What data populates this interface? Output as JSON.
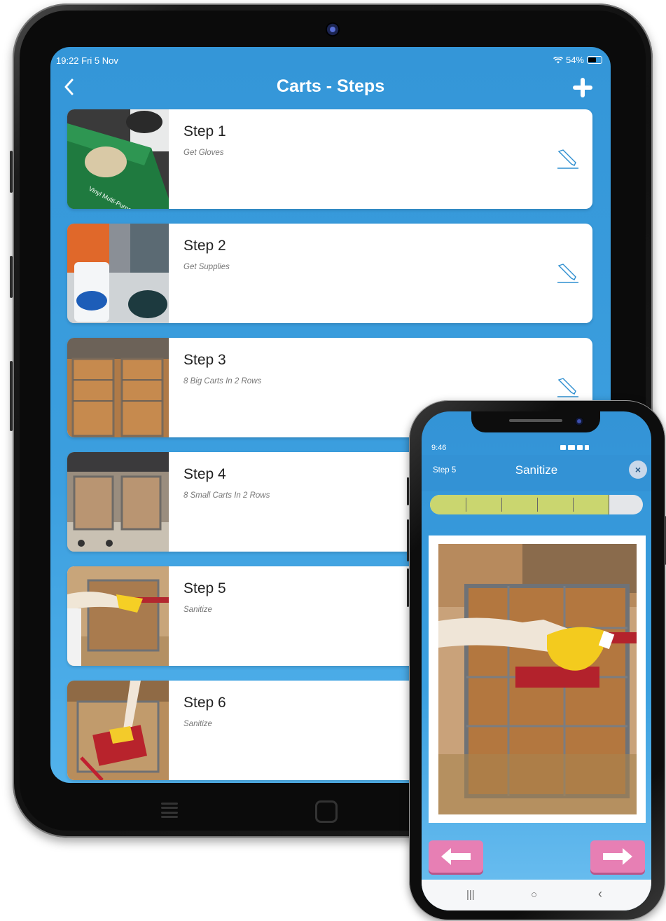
{
  "tablet": {
    "status": {
      "time": "19:22  Fri 5 Nov",
      "battery": "54%"
    },
    "nav": {
      "title": "Carts - Steps",
      "back_icon": "chevron-left-icon",
      "add_icon": "plus-icon"
    },
    "steps": [
      {
        "title": "Step 1",
        "subtitle": "Get Gloves",
        "image": "gloves-box-photo"
      },
      {
        "title": "Step 2",
        "subtitle": "Get Supplies",
        "image": "cleaning-supplies-photo"
      },
      {
        "title": "Step 3",
        "subtitle": "8 Big Carts In 2 Rows",
        "image": "big-carts-rows-photo"
      },
      {
        "title": "Step 4",
        "subtitle": "8 Small Carts In 2 Rows",
        "image": "small-carts-rows-photo"
      },
      {
        "title": "Step 5",
        "subtitle": "Sanitize",
        "image": "sanitize-handle-photo"
      },
      {
        "title": "Step 6",
        "subtitle": "Sanitize",
        "image": "sanitize-seat-photo"
      }
    ]
  },
  "phone": {
    "status": {
      "time": "9:46"
    },
    "header": {
      "step_label": "Step 5",
      "title": "Sanitize",
      "close_label": "×"
    },
    "progress": {
      "segments_total": 6,
      "segments_done": 5,
      "fraction": 0.84
    },
    "photo": "sanitize-cart-handle-photo",
    "nav": {
      "back_icon": "arrow-left-icon",
      "next_icon": "arrow-right-icon",
      "android_recent": "|||",
      "android_home": "○",
      "android_back": "‹"
    }
  },
  "colors": {
    "primary_blue": "#3496d8",
    "pink_button": "#e77fb4",
    "progress_green": "#cad66f"
  }
}
